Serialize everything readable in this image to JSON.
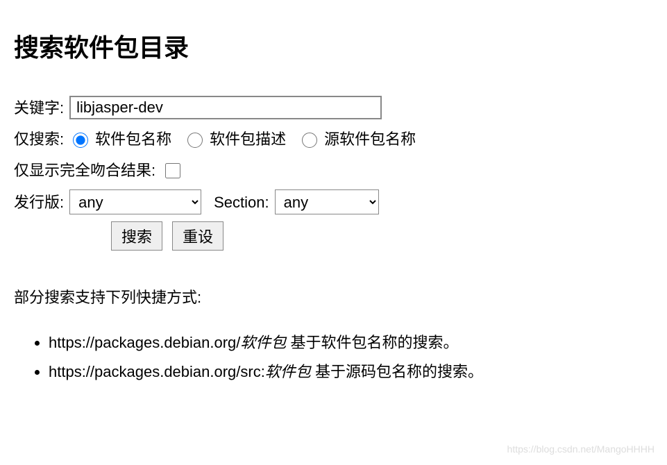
{
  "heading": "搜索软件包目录",
  "form": {
    "keyword_label": "关键字:",
    "keyword_value": "libjasper-dev",
    "search_on_label": "仅搜索:",
    "radio_options": {
      "pkg_name": "软件包名称",
      "pkg_desc": "软件包描述",
      "src_pkg_name": "源软件包名称"
    },
    "exact_label": "仅显示完全吻合结果:",
    "distribution_label": "发行版:",
    "distribution_value": "any",
    "section_label": "Section:",
    "section_value": "any",
    "search_button": "搜索",
    "reset_button": "重设"
  },
  "shortcuts": {
    "intro": "部分搜索支持下列快捷方式:",
    "item1_prefix": "https://packages.debian.org/",
    "item1_param": "软件包",
    "item1_suffix": " 基于软件包名称的搜索。",
    "item2_prefix": "https://packages.debian.org/src:",
    "item2_param": "软件包",
    "item2_suffix": " 基于源码包名称的搜索。"
  },
  "watermark": "https://blog.csdn.net/MangoHHHH"
}
